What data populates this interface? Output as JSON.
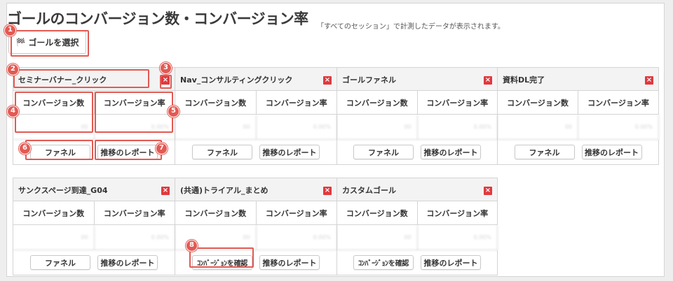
{
  "page": {
    "title": "ゴールのコンバージョン数・コンバージョン率",
    "subtitle": "「すべてのセッション」で計測したデータが表示されます。",
    "select_goal_label": "ゴールを選択",
    "flag_icon": "🏁"
  },
  "columns": {
    "conversions": "コンバージョン数",
    "rate": "コンバージョン率"
  },
  "buttons": {
    "funnel": "ファネル",
    "trend_report": "推移のレポート",
    "check_conversion": "ｺﾝﾊﾞｰｼﾞｮﾝを確認"
  },
  "close_glyph": "×",
  "blurred_values": {
    "count": "00",
    "rate": "0.00%"
  },
  "goals": [
    {
      "name": "セミナーバナー_クリック"
    },
    {
      "name": "Nav_コンサルティングクリック"
    },
    {
      "name": "ゴールファネル"
    },
    {
      "name": "資料DL完了"
    },
    {
      "name": "サンクスページ到達_G04"
    },
    {
      "name": "(共通)トライアル_まとめ"
    },
    {
      "name": "カスタムゴール"
    }
  ],
  "annotations": [
    "1",
    "2",
    "3",
    "4",
    "5",
    "6",
    "7",
    "8"
  ],
  "colors": {
    "annotation": "#e25a53",
    "close": "#e0393e",
    "header_bg": "#f3f3f3",
    "border": "#d4d4d4"
  }
}
